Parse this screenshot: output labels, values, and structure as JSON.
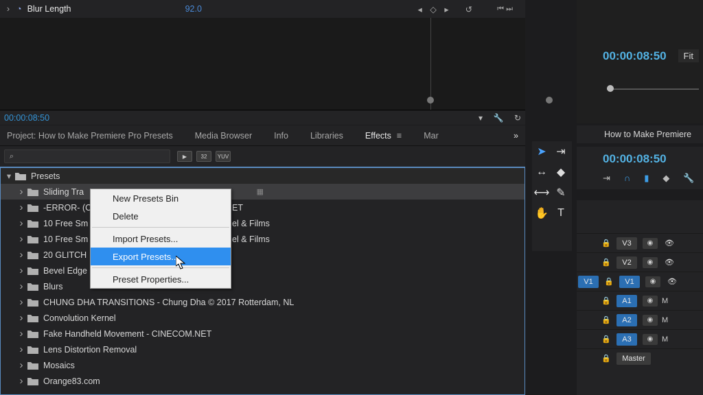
{
  "effectControls": {
    "paramName": "Blur Length",
    "paramValue": "92.0",
    "keyframeNav": "◂ ◇ ▸",
    "reset": "↺",
    "navIcons": "⏮ ⏭",
    "timecode": "00:00:08:50"
  },
  "tabs": {
    "project": "Project: How to Make Premiere Pro Presets",
    "mediaBrowser": "Media Browser",
    "info": "Info",
    "libraries": "Libraries",
    "effects": "Effects",
    "markers": "Mar"
  },
  "search": {
    "placeholder": "",
    "chip1": "▶",
    "chip2": "32",
    "chip3": "YUV"
  },
  "presetRoot": "Presets",
  "presets": [
    "Sliding Tra",
    "-ERROR- (C",
    "10 Free Sm",
    "10 Free Sm",
    "20 GLITCH",
    "Bevel Edge",
    "Blurs",
    "CHUNG DHA TRANSITIONS - Chung Dha © 2017 Rotterdam, NL",
    "Convolution Kernel",
    "Fake Handheld Movement - CINECOM.NET",
    "Lens Distortion Removal",
    "Mosaics",
    "Orange83.com"
  ],
  "presetTails": [
    "",
    "ET",
    "el & Films",
    "el & Films",
    "",
    "",
    "",
    "",
    "",
    "",
    "",
    "",
    ""
  ],
  "contextMenu": {
    "newBin": "New Presets Bin",
    "delete": "Delete",
    "import": "Import Presets...",
    "export": "Export Presets...",
    "props": "Preset Properties..."
  },
  "programMonitor": {
    "timecode": "00:00:08:50",
    "fit": "Fit",
    "seqTitle": "How to Make Premiere"
  },
  "sequence": {
    "timecode": "00:00:08:50"
  },
  "tracks": [
    {
      "src": "",
      "seq": "V3",
      "type": "video"
    },
    {
      "src": "",
      "seq": "V2",
      "type": "video"
    },
    {
      "src": "V1",
      "seq": "V1",
      "type": "video-src"
    },
    {
      "src": "",
      "seq": "A1",
      "type": "audio"
    },
    {
      "src": "",
      "seq": "A2",
      "type": "audio"
    },
    {
      "src": "",
      "seq": "A3",
      "type": "audio"
    },
    {
      "src": "",
      "seq": "Master",
      "type": "master"
    }
  ],
  "trackLetters": {
    "m": "M"
  }
}
